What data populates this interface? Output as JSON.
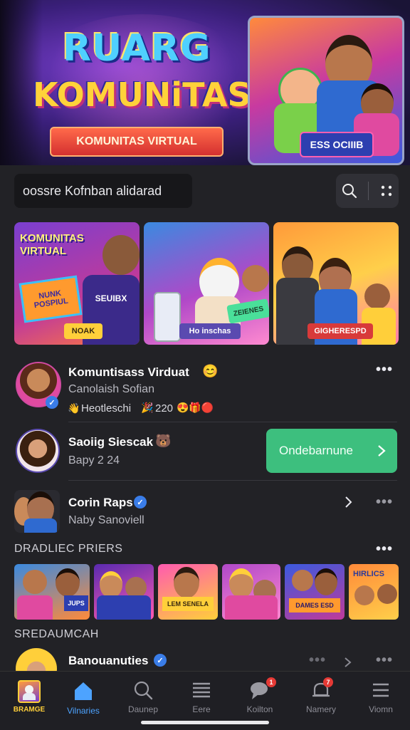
{
  "hero": {
    "title_line1": "RUARG",
    "title_line2": "KOMUNiTAS",
    "ribbon": "KOMUNITAS VIRTUAL",
    "card_badge": "ESS OCIIIB"
  },
  "search": {
    "placeholder": "oossre Kofnban alidarad"
  },
  "featured": [
    {
      "title": "KOMUNITAS VIRTUAL",
      "sign": "NUNK POSPIUL",
      "shirt": "SEUIBX",
      "label": "NOAK"
    },
    {
      "sign": "ZEIENES",
      "label": "Ho inschas"
    },
    {
      "label": "GIGHERESPD"
    }
  ],
  "posts": [
    {
      "title": "Komuntisass Virduat",
      "subtitle": "Canolaish Sofian",
      "reactions": "Heotleschi",
      "count": "220"
    },
    {
      "title": "Saoiig Siescak",
      "subtitle": "Bapy 2 24",
      "action": "Ondebarnune"
    },
    {
      "title": "Corin Raps",
      "subtitle": "Naby Sanoviell"
    }
  ],
  "sections": {
    "s1": "DRADLIEC PRIERS",
    "s2": "SREDAUMCAH"
  },
  "thumbs": [
    {
      "text": "JUPS"
    },
    {
      "text": ""
    },
    {
      "text": "LEM SENELA"
    },
    {
      "text": ""
    },
    {
      "text": "DAMES ESD"
    },
    {
      "text": "HIRLICS"
    }
  ],
  "last_row": {
    "title": "Banouanuties"
  },
  "nav": [
    {
      "label": "BRAMGE",
      "icon": "profile-avatar-icon"
    },
    {
      "label": "Vilnaries",
      "icon": "home-icon",
      "active": true
    },
    {
      "label": "Daunep",
      "icon": "search-icon"
    },
    {
      "label": "Eere",
      "icon": "feed-icon"
    },
    {
      "label": "Koilton",
      "icon": "chat-icon",
      "badge": "1"
    },
    {
      "label": "Namery",
      "icon": "bell-icon",
      "badge": "7"
    },
    {
      "label": "Viomn",
      "icon": "menu-icon"
    }
  ],
  "colors": {
    "accent": "#4da3ff",
    "action_button": "#3dbf7e",
    "background": "#222226"
  }
}
